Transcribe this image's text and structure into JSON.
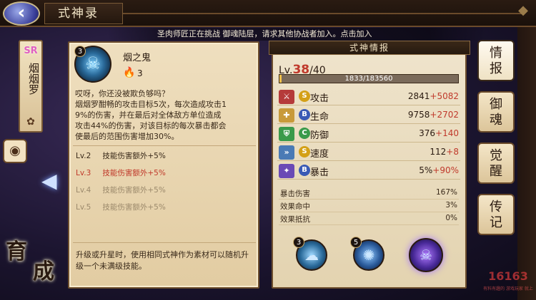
{
  "topbar": {
    "title": "式神录",
    "back_icon": "back-arrow-icon"
  },
  "banner": {
    "text": "圣肉师匠正在挑战 御魂陆层，请求其他协战者加入。点击加入"
  },
  "character": {
    "rarity": "SR",
    "name": "烟烟罗"
  },
  "left_buttons": {
    "nurture_chars": [
      "育",
      "成"
    ]
  },
  "skill": {
    "badge_level": "3",
    "name": "烟之鬼",
    "cost": "3",
    "description": "哎呀，你还没被欺负够吗？\n烟烟罗酣畅的攻击目标5次，每次造成攻击1\n9%的伤害，并在最后对全体敌方单位造成\n攻击44%的伤害，对该目标的每次暴击都会\n使最后的范围伤害增加30%。",
    "levels": [
      {
        "lv": "Lv.2",
        "text": "技能伤害额外+5%",
        "state": "done"
      },
      {
        "lv": "Lv.3",
        "text": "技能伤害额外+5%",
        "state": "current"
      },
      {
        "lv": "Lv.4",
        "text": "技能伤害额外+5%",
        "state": "locked"
      },
      {
        "lv": "Lv.5",
        "text": "技能伤害额外+5%",
        "state": "locked"
      }
    ],
    "upgrade_note": "升级或升星时，使用相同式神作为素材可以随机升级一个未满级技能。"
  },
  "info": {
    "header": "式神情报",
    "level_prefix": "Lv.",
    "level_current": "38",
    "level_max": "/40",
    "exp_text": "1833/183560",
    "exp_fraction": 0.01,
    "stats": [
      {
        "grade": "S",
        "name": "攻击",
        "base": "2841",
        "bonus": "+5082",
        "icon_color": "#b53a3a",
        "grade_color": "#d4a017"
      },
      {
        "grade": "B",
        "name": "生命",
        "base": "9758",
        "bonus": "+2702",
        "icon_color": "#c89a3a",
        "grade_color": "#3a5ab5"
      },
      {
        "grade": "C",
        "name": "防御",
        "base": "376",
        "bonus": "+140",
        "icon_color": "#3a9a4a",
        "grade_color": "#3a9a4a"
      },
      {
        "grade": "S",
        "name": "速度",
        "base": "112",
        "bonus": "+8",
        "icon_color": "#4a7ab5",
        "grade_color": "#d4a017"
      },
      {
        "grade": "B",
        "name": "暴击",
        "base": "5%",
        "bonus": "+90%",
        "icon_color": "#6a4ab5",
        "grade_color": "#3a5ab5"
      }
    ],
    "substats": [
      {
        "label": "暴击伤害",
        "value": "167%"
      },
      {
        "label": "效果命中",
        "value": "3%"
      },
      {
        "label": "效果抵抗",
        "value": "0%"
      }
    ],
    "skill_orbs": [
      {
        "badge": "3",
        "icon": "ghost-icon"
      },
      {
        "badge": "5",
        "icon": "swirl-icon"
      },
      {
        "badge": "",
        "icon": "demon-face-icon"
      }
    ]
  },
  "tabs": [
    {
      "label": [
        "情",
        "报"
      ],
      "active": true
    },
    {
      "label": [
        "御",
        "魂"
      ],
      "active": false
    },
    {
      "label": [
        "觉",
        "醒"
      ],
      "active": false
    },
    {
      "label": [
        "传",
        "记"
      ],
      "active": false
    }
  ],
  "watermark": {
    "text": "16163",
    "sub": "有料有趣的 游戏玩家 就上"
  }
}
